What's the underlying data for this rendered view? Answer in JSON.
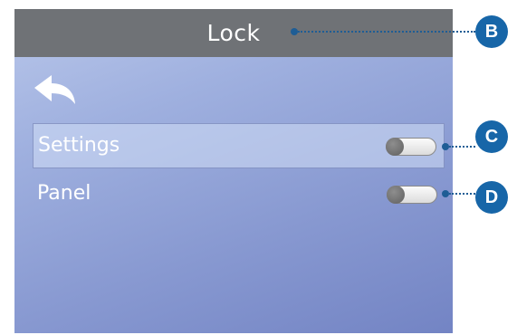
{
  "screen": {
    "title": "Lock",
    "back_icon": "back-arrow-icon",
    "rows": [
      {
        "label": "Settings",
        "selected": true,
        "toggle_on": false
      },
      {
        "label": "Panel",
        "selected": false,
        "toggle_on": false
      }
    ]
  },
  "callouts": [
    "B",
    "C",
    "D"
  ],
  "colors": {
    "header": "#6f7276",
    "background_top": "#b9c7ea",
    "background_bottom": "#7384c4",
    "callout": "#1766a8",
    "text": "#ffffff"
  }
}
